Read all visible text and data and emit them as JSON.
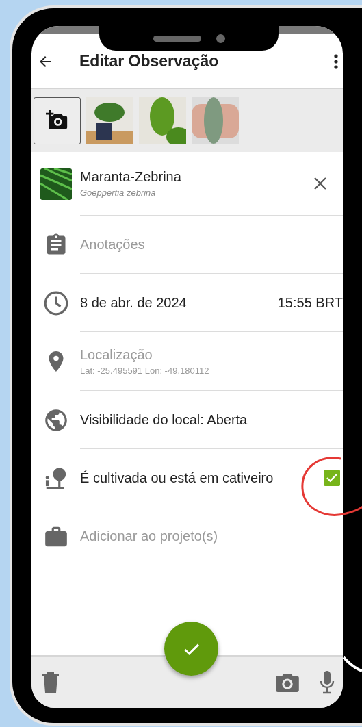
{
  "header": {
    "title": "Editar Observação"
  },
  "photos": [
    {
      "kind": "plant-pot"
    },
    {
      "kind": "leaf"
    },
    {
      "kind": "hand-leaf"
    }
  ],
  "taxon": {
    "common_name": "Maranta-Zebrina",
    "scientific_name": "Goeppertia zebrina"
  },
  "fields": [
    {
      "kind": "notes",
      "placeholder": "Anotações"
    },
    {
      "kind": "datetime",
      "date": "8 de abr. de 2024",
      "time": "15:55 BRT"
    },
    {
      "kind": "location",
      "label": "Localização",
      "coords": "Lat: -25.495591 Lon: -49.180112"
    },
    {
      "kind": "visibility",
      "label": "Visibilidade do local: Aberta"
    },
    {
      "kind": "captive",
      "label": "É cultivada ou está em cativeiro",
      "checked": true
    },
    {
      "kind": "project",
      "placeholder": "Adicionar ao projeto(s)"
    }
  ]
}
